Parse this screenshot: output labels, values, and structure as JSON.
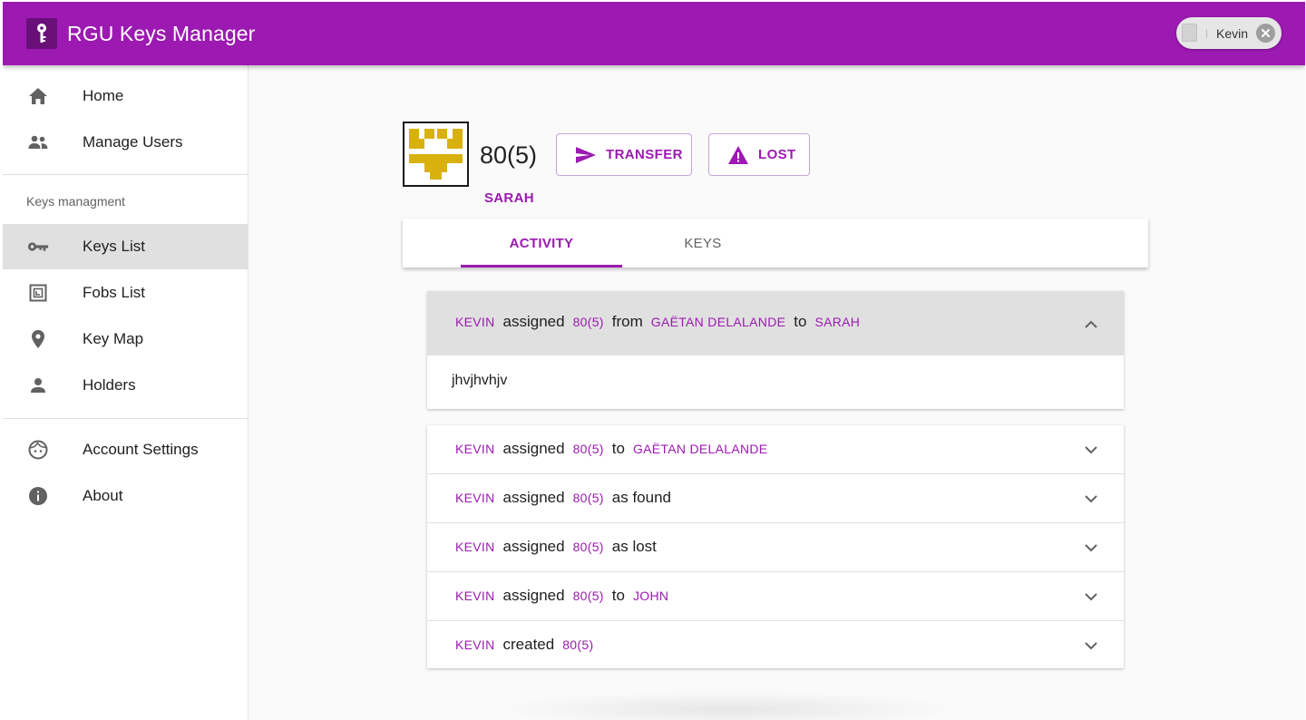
{
  "app": {
    "title": "RGU Keys Manager",
    "icon": "key-icon",
    "accent": "#9c1ab1"
  },
  "user": {
    "name": "Kevin"
  },
  "sidebar": {
    "top_items": [
      {
        "label": "Home",
        "icon": "home-icon"
      },
      {
        "label": "Manage Users",
        "icon": "people-icon"
      }
    ],
    "section_header": "Keys managment",
    "key_items": [
      {
        "label": "Keys List",
        "icon": "key-icon",
        "active": true
      },
      {
        "label": "Fobs List",
        "icon": "fob-icon"
      },
      {
        "label": "Key Map",
        "icon": "location-pin-icon"
      },
      {
        "label": "Holders",
        "icon": "person-icon"
      }
    ],
    "bottom_items": [
      {
        "label": "Account Settings",
        "icon": "face-icon"
      },
      {
        "label": "About",
        "icon": "info-icon"
      }
    ]
  },
  "key": {
    "title": "80(5)",
    "holder": "SARAH",
    "actions": {
      "transfer": "TRANSFER",
      "lost": "LOST"
    }
  },
  "tabs": [
    {
      "label": "ACTIVITY",
      "active": true
    },
    {
      "label": "KEYS",
      "active": false
    }
  ],
  "activity": {
    "expanded": {
      "actor": "KEVIN",
      "verb": "assigned",
      "key": "80(5)",
      "from_word": "from",
      "from": "GAËTAN DELALANDE",
      "to_word": "to",
      "to": "SARAH",
      "note": "jhvjhvhjv"
    },
    "entries": [
      {
        "actor": "KEVIN",
        "verb": "assigned",
        "key": "80(5)",
        "tail_word": "to",
        "tail_ref": "GAËTAN DELALANDE"
      },
      {
        "actor": "KEVIN",
        "verb": "assigned",
        "key": "80(5)",
        "tail_word": "as found",
        "tail_ref": ""
      },
      {
        "actor": "KEVIN",
        "verb": "assigned",
        "key": "80(5)",
        "tail_word": "as lost",
        "tail_ref": ""
      },
      {
        "actor": "KEVIN",
        "verb": "assigned",
        "key": "80(5)",
        "tail_word": "to",
        "tail_ref": "JOHN"
      },
      {
        "actor": "KEVIN",
        "verb": "created",
        "key": "80(5)",
        "tail_word": "",
        "tail_ref": ""
      }
    ]
  }
}
